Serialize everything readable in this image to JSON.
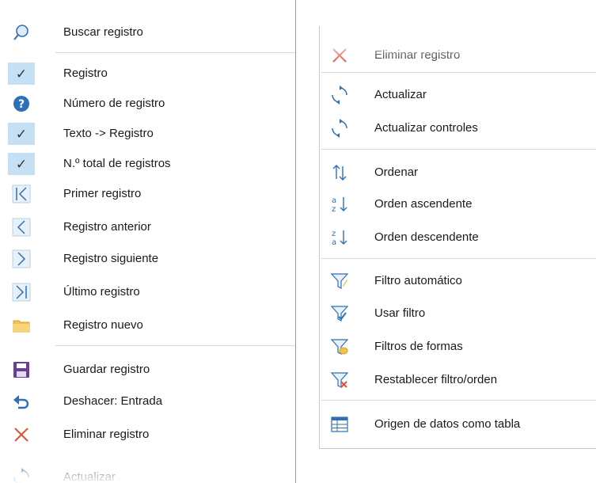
{
  "left_menu": {
    "items": [
      {
        "label": "Buscar registro",
        "icon": "search-icon"
      },
      {
        "label": "Registro",
        "icon": "checkmark-icon",
        "checked": true
      },
      {
        "label": "Número de registro",
        "icon": "help-circle-icon"
      },
      {
        "label": "Texto -> Registro",
        "icon": "checkmark-icon",
        "checked": true
      },
      {
        "label": "N.º total de registros",
        "icon": "checkmark-icon",
        "checked": true
      },
      {
        "label": "Primer registro",
        "icon": "first-record-icon"
      },
      {
        "label": "Registro anterior",
        "icon": "previous-record-icon"
      },
      {
        "label": "Registro siguiente",
        "icon": "next-record-icon"
      },
      {
        "label": "Último registro",
        "icon": "last-record-icon"
      },
      {
        "label": "Registro nuevo",
        "icon": "folder-icon"
      },
      {
        "label": "Guardar registro",
        "icon": "save-icon"
      },
      {
        "label": "Deshacer: Entrada",
        "icon": "undo-icon"
      },
      {
        "label": "Eliminar registro",
        "icon": "delete-icon"
      },
      {
        "label": "Actualizar",
        "icon": "refresh-icon"
      }
    ]
  },
  "right_menu": {
    "items": [
      {
        "label": "Eliminar registro",
        "icon": "delete-icon"
      },
      {
        "label": "Actualizar",
        "icon": "refresh-icon"
      },
      {
        "label": "Actualizar controles",
        "icon": "refresh-controls-icon"
      },
      {
        "label": "Ordenar",
        "icon": "sort-icon"
      },
      {
        "label": "Orden ascendente",
        "icon": "sort-ascending-icon"
      },
      {
        "label": "Orden descendente",
        "icon": "sort-descending-icon"
      },
      {
        "label": "Filtro automático",
        "icon": "autofilter-icon"
      },
      {
        "label": "Usar filtro",
        "icon": "apply-filter-icon"
      },
      {
        "label": "Filtros de formas",
        "icon": "form-filter-icon"
      },
      {
        "label": "Restablecer filtro/orden",
        "icon": "reset-filter-icon"
      },
      {
        "label": "Origen de datos como tabla",
        "icon": "datasource-table-icon"
      }
    ]
  },
  "colors": {
    "checked_bg": "#c5e0f5",
    "icon_blue": "#2f6fb5",
    "icon_red": "#e0533a",
    "icon_purple": "#6a3d9a",
    "folder_yellow": "#f2c14e",
    "separator": "#d8d8d8"
  }
}
